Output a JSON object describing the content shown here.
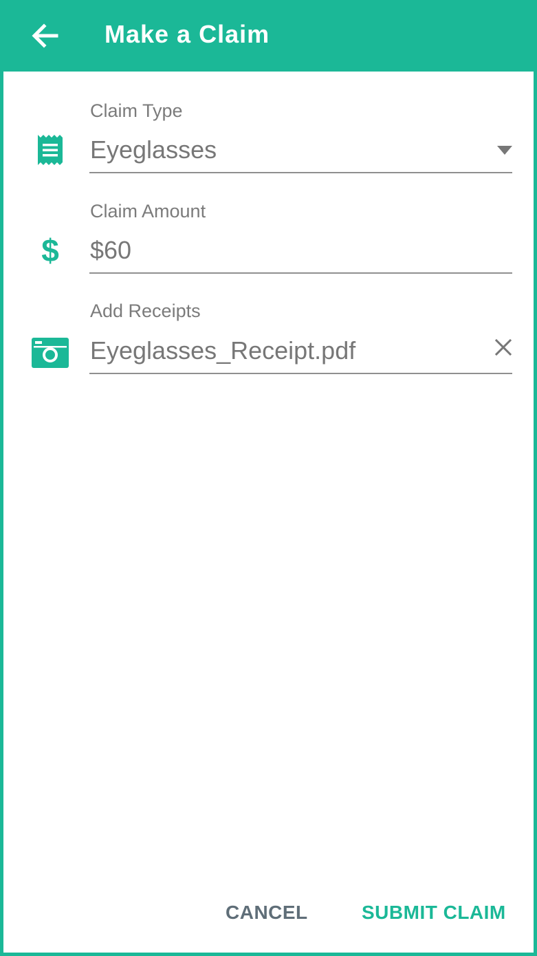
{
  "appbar": {
    "title": "Make a Claim",
    "back_icon": "arrow-left-icon",
    "background": "#1bb897"
  },
  "form": {
    "claim_type": {
      "label": "Claim Type",
      "value": "Eyeglasses",
      "icon": "receipt-icon"
    },
    "claim_amount": {
      "label": "Claim Amount",
      "value": "$60",
      "icon": "dollar-icon",
      "icon_glyph": "$"
    },
    "receipts": {
      "label": "Add Receipts",
      "value": "Eyeglasses_Receipt.pdf",
      "icon": "camera-icon"
    }
  },
  "actions": {
    "cancel_label": "CANCEL",
    "submit_label": "SUBMIT CLAIM"
  },
  "colors": {
    "accent": "#1bb897",
    "label": "#7b7b7b",
    "value": "#777777",
    "cancel": "#5f6e78"
  }
}
